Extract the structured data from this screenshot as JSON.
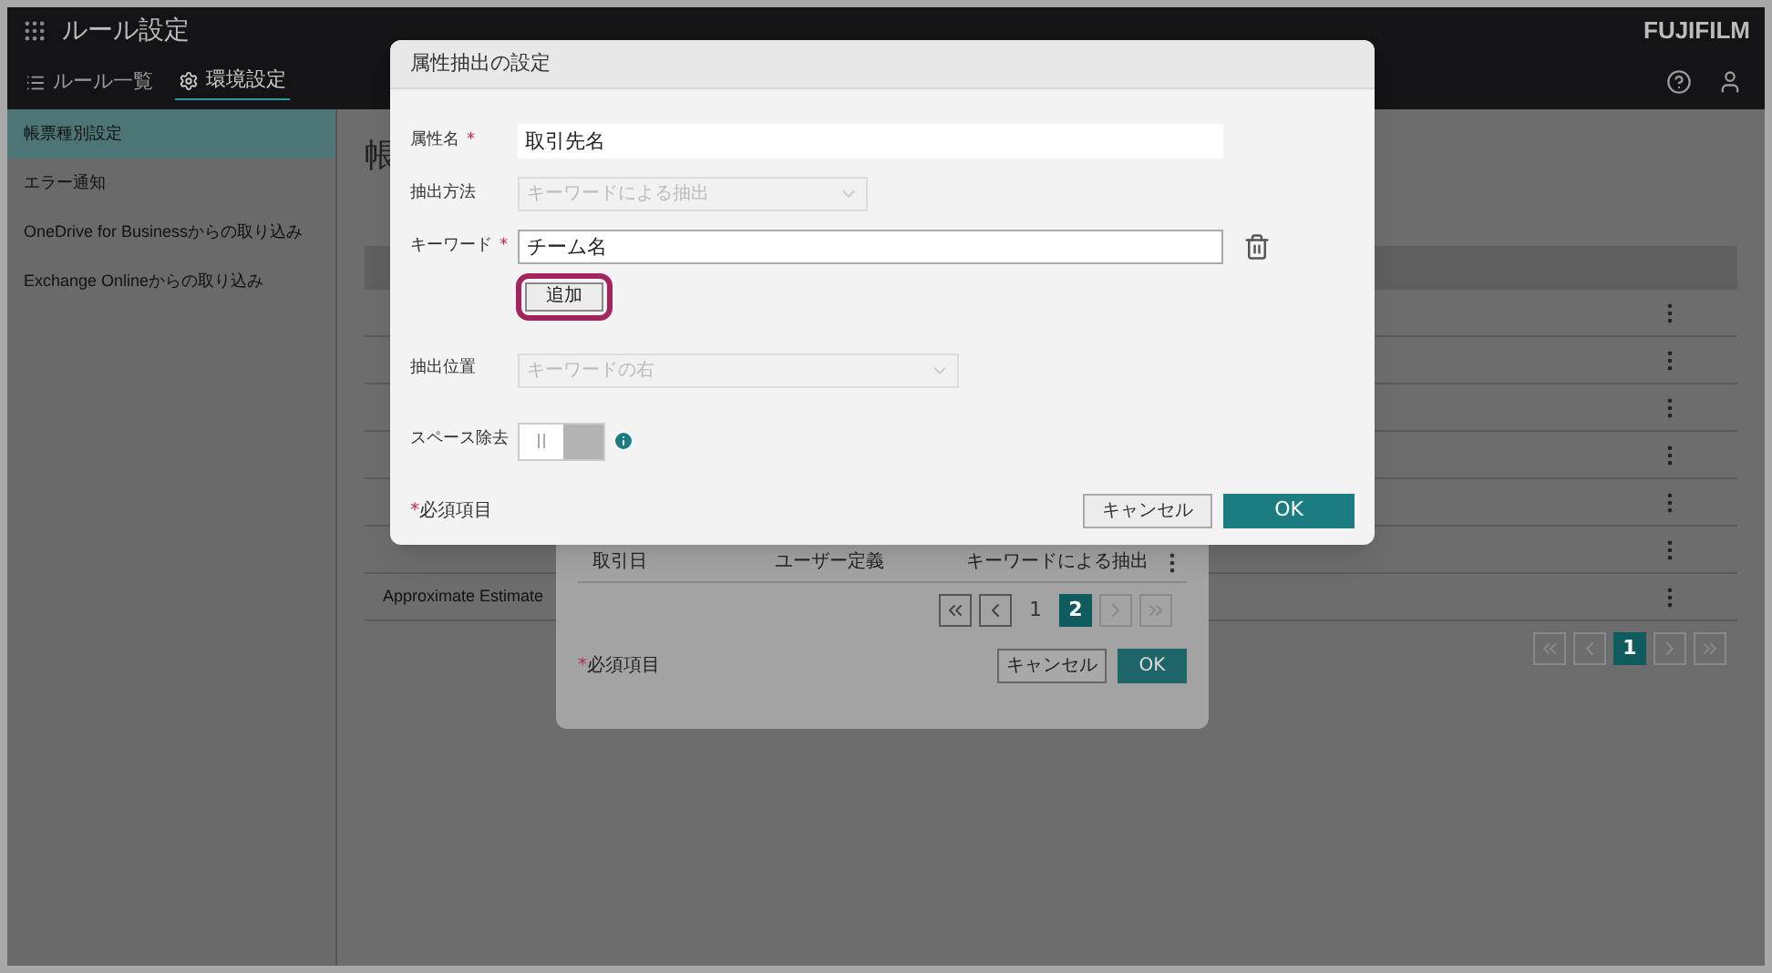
{
  "app": {
    "title": "ルール設定",
    "logo": "FUJIFILM"
  },
  "nav_tabs": [
    {
      "label": "ルール一覧",
      "selected": false
    },
    {
      "label": "環境設定",
      "selected": true
    }
  ],
  "sidebar": {
    "items": [
      {
        "label": "帳票種別設定",
        "selected": true
      },
      {
        "label": "エラー通知",
        "selected": false
      },
      {
        "label": "OneDrive for Businessからの取り込み",
        "selected": false
      },
      {
        "label": "Exchange Onlineからの取り込み",
        "selected": false
      }
    ]
  },
  "main": {
    "heading": "帳",
    "rows": [
      {
        "name": null
      },
      {
        "name": null
      },
      {
        "name": null
      },
      {
        "name": null
      },
      {
        "name": null
      },
      {
        "name": null
      },
      {
        "name": "Approximate Estimate"
      }
    ],
    "pagination": {
      "pages": [
        {
          "label": "1",
          "selected": true
        }
      ],
      "nav": [
        {
          "kind": "first",
          "disabled": true
        },
        {
          "kind": "prev",
          "disabled": true
        },
        {
          "kind": "next",
          "disabled": true
        },
        {
          "kind": "last",
          "disabled": true
        }
      ]
    }
  },
  "back_dialog": {
    "row": {
      "cells": [
        "取引日",
        "ユーザー定義",
        "キーワードによる抽出"
      ]
    },
    "pagination": {
      "pages": [
        {
          "label": "1",
          "selected": false
        },
        {
          "label": "2",
          "selected": true
        }
      ],
      "nav": [
        {
          "kind": "first",
          "disabled": false
        },
        {
          "kind": "prev",
          "disabled": false
        },
        {
          "kind": "next",
          "disabled": true
        },
        {
          "kind": "last",
          "disabled": true
        }
      ]
    },
    "required_note": {
      "mark": "*",
      "text": "必須項目"
    },
    "cancel": "キャンセル",
    "ok": "OK"
  },
  "dialog": {
    "title": "属性抽出の設定",
    "fields": [
      {
        "kind": "text",
        "label": "属性名",
        "required_mark": "*",
        "value": "取引先名"
      },
      {
        "kind": "select",
        "label": "抽出方法",
        "value": "キーワードによる抽出",
        "disabled": true
      },
      {
        "kind": "keyword",
        "label": "キーワード",
        "required_mark": "*",
        "value": "チーム名",
        "add_button": {
          "label": "追加",
          "highlighted": true
        }
      },
      {
        "kind": "select",
        "label": "抽出位置",
        "value": "キーワードの右",
        "disabled": true
      },
      {
        "kind": "toggle",
        "label": "スペース除去",
        "on": false
      }
    ],
    "required_note": {
      "mark": "*",
      "text": "必須項目"
    },
    "cancel": "キャンセル",
    "ok": "OK"
  }
}
